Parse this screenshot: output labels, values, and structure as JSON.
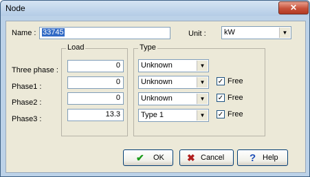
{
  "window": {
    "title": "Node",
    "close_glyph": "✕"
  },
  "name": {
    "label": "Name :",
    "value": "33745"
  },
  "unit": {
    "label": "Unit :",
    "value": "kW"
  },
  "load_group": {
    "label": "Load"
  },
  "type_group": {
    "label": "Type"
  },
  "rows": [
    {
      "label": "Three phase :",
      "load": "0",
      "type": "Unknown",
      "has_free": false
    },
    {
      "label": "Phase1 :",
      "load": "0",
      "type": "Unknown",
      "has_free": true,
      "free_label": "Free",
      "free_checked": true
    },
    {
      "label": "Phase2 :",
      "load": "0",
      "type": "Unknown",
      "has_free": true,
      "free_label": "Free",
      "free_checked": true
    },
    {
      "label": "Phase3 :",
      "load": "13.3",
      "type": "Type 1",
      "has_free": true,
      "free_label": "Free",
      "free_checked": true
    }
  ],
  "buttons": {
    "ok": {
      "label": "OK",
      "icon": "checkmark-icon",
      "icon_glyph": "✔",
      "color": "#1a9b1a"
    },
    "cancel": {
      "label": "Cancel",
      "icon": "cross-icon",
      "icon_glyph": "✖",
      "color": "#b01e1e"
    },
    "help": {
      "label": "Help",
      "icon": "question-icon",
      "icon_glyph": "?",
      "color": "#1f4fb8"
    }
  },
  "check_glyph": "✓",
  "dropdown_glyph": "▼"
}
